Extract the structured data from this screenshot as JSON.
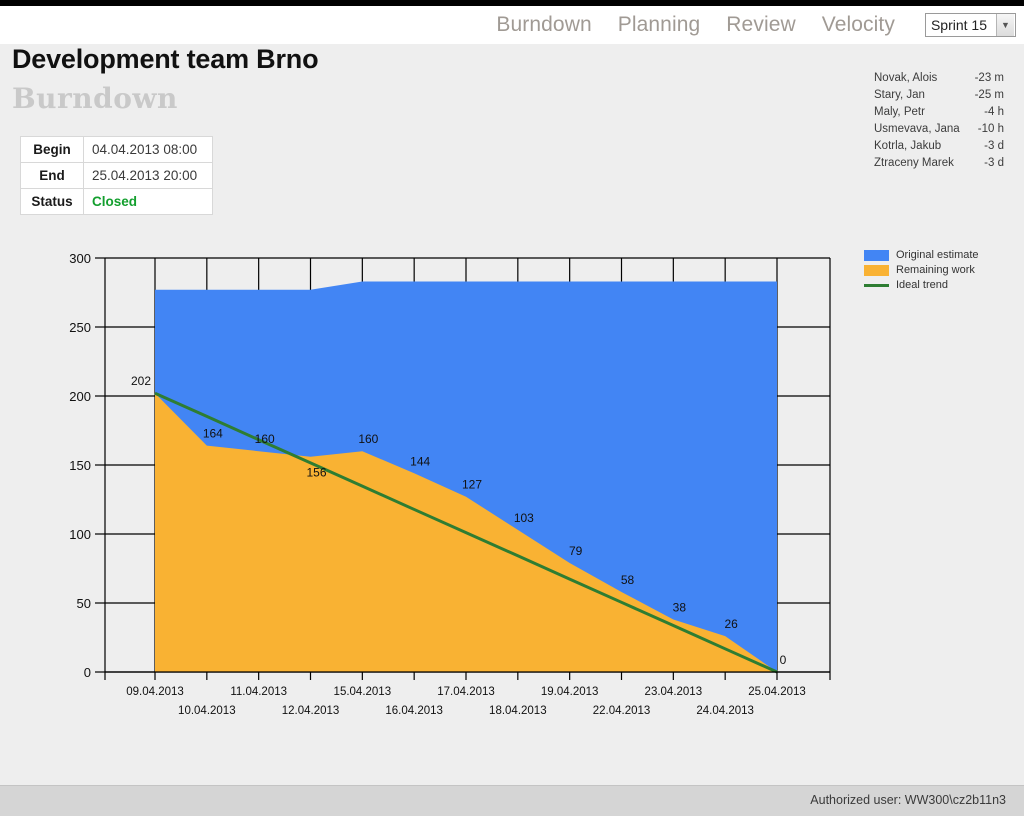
{
  "nav": {
    "links": [
      {
        "label": "Burndown"
      },
      {
        "label": "Planning"
      },
      {
        "label": "Review"
      },
      {
        "label": "Velocity"
      }
    ],
    "sprint_select": {
      "value": "Sprint 15",
      "arrow": "chevron-down-icon"
    }
  },
  "header": {
    "title": "Development team Brno",
    "subtitle": "Burndown"
  },
  "info": {
    "rows": [
      {
        "key": "Begin",
        "value": "04.04.2013 08:00",
        "state": "normal"
      },
      {
        "key": "End",
        "value": "25.04.2013 20:00",
        "state": "normal"
      },
      {
        "key": "Status",
        "value": "Closed",
        "state": "closed"
      }
    ]
  },
  "members": [
    {
      "name": "Novak, Alois",
      "value": "-23 m"
    },
    {
      "name": "Stary, Jan",
      "value": "-25 m"
    },
    {
      "name": "Maly, Petr",
      "value": "-4 h"
    },
    {
      "name": "Usmevava, Jana",
      "value": "-10 h"
    },
    {
      "name": "Kotrla, Jakub",
      "value": "-3 d"
    },
    {
      "name": "Ztraceny Marek",
      "value": "-3 d"
    }
  ],
  "legend": {
    "items": [
      {
        "label": "Original estimate",
        "color": "#4285f4",
        "kind": "area"
      },
      {
        "label": "Remaining work",
        "color": "#f9b233",
        "kind": "area"
      },
      {
        "label": "Ideal trend",
        "color": "#2e7d32",
        "kind": "line"
      }
    ]
  },
  "footer": {
    "authorized_user": "Authorized user: WW300\\cz2b11n3"
  },
  "chart_data": {
    "type": "area",
    "title": "",
    "xlabel": "",
    "ylabel": "",
    "ylim": [
      0,
      300
    ],
    "yticks": [
      0,
      50,
      100,
      150,
      200,
      250,
      300
    ],
    "grid": true,
    "legend_position": "right-top",
    "categories": [
      "09.04.2013",
      "10.04.2013",
      "11.04.2013",
      "12.04.2013",
      "15.04.2013",
      "16.04.2013",
      "17.04.2013",
      "18.04.2013",
      "19.04.2013",
      "22.04.2013",
      "23.04.2013",
      "24.04.2013",
      "25.04.2013"
    ],
    "series": [
      {
        "name": "Original estimate",
        "color": "#4285f4",
        "values": [
          277,
          277,
          277,
          277,
          283,
          283,
          283,
          283,
          283,
          283,
          283,
          283,
          283
        ]
      },
      {
        "name": "Remaining work",
        "color": "#f9b233",
        "values": [
          202,
          164,
          160,
          156,
          160,
          144,
          127,
          103,
          79,
          58,
          38,
          26,
          0
        ],
        "labels": [
          "202",
          "164",
          "160",
          "156",
          "160",
          "144",
          "127",
          "103",
          "79",
          "58",
          "38",
          "26",
          "0"
        ]
      },
      {
        "name": "Ideal trend",
        "color": "#2e7d32",
        "values": [
          202,
          185.2,
          168.3,
          151.5,
          134.7,
          117.8,
          101,
          84.2,
          67.3,
          50.5,
          33.7,
          16.8,
          0
        ]
      }
    ]
  }
}
